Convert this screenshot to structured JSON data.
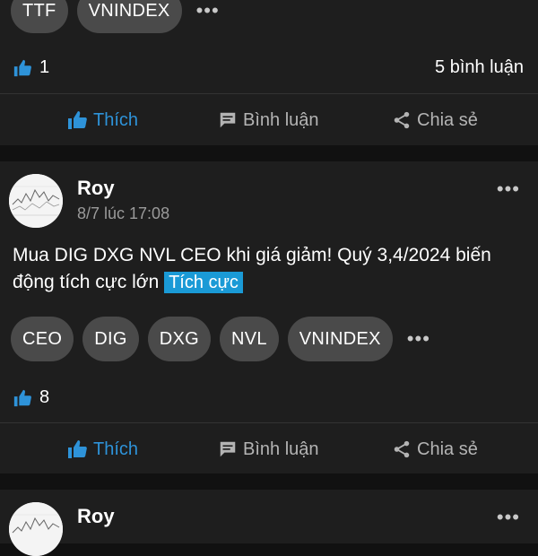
{
  "post_top": {
    "tags": [
      "TTF",
      "VNINDEX"
    ],
    "more": "•••",
    "likes": "1",
    "comments": "5 bình luận",
    "actions": {
      "like": "Thích",
      "comment": "Bình luận",
      "share": "Chia sẻ"
    }
  },
  "post_main": {
    "author": "Roy",
    "time": "8/7 lúc 17:08",
    "menu": "•••",
    "content": "Mua DIG DXG NVL CEO khi giá giảm! Quý 3,4/2024 biến động tích cực lớn",
    "sentiment": "Tích cực",
    "tags": [
      "CEO",
      "DIG",
      "DXG",
      "NVL",
      "VNINDEX"
    ],
    "more": "•••",
    "likes": "8",
    "actions": {
      "like": "Thích",
      "comment": "Bình luận",
      "share": "Chia sẻ"
    }
  },
  "post_bottom": {
    "author": "Roy",
    "menu": "•••"
  },
  "colors": {
    "background": "#111111",
    "card": "#1e1e1e",
    "chip": "#4a4a4a",
    "accent_blue": "#2e93d9",
    "badge_blue": "#1a9ad6",
    "muted_text": "#b4b4b4"
  }
}
